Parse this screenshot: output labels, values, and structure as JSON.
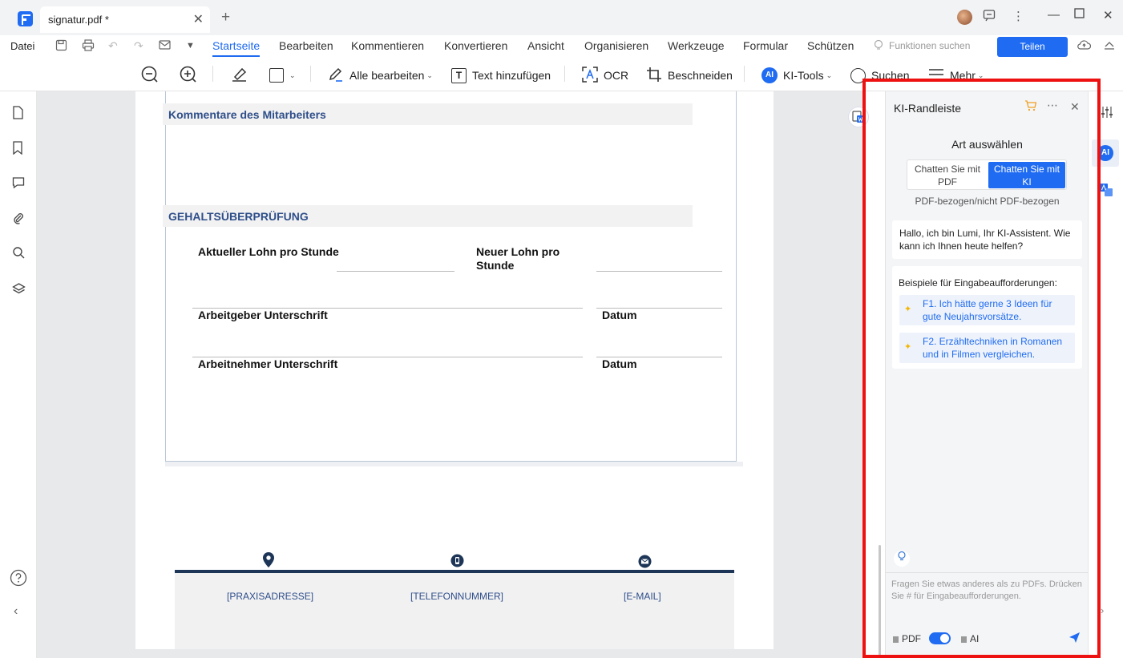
{
  "titlebar": {
    "tab_name": "signatur.pdf *",
    "close": "✕",
    "new_tab": "+"
  },
  "menubar": {
    "file": "Datei",
    "tabs": [
      "Startseite",
      "Bearbeiten",
      "Kommentieren",
      "Konvertieren",
      "Ansicht",
      "Organisieren",
      "Werkzeuge",
      "Formular",
      "Schützen"
    ],
    "feature_search": "Funktionen suchen",
    "share": "Teilen"
  },
  "toolbar": {
    "edit_all": "Alle bearbeiten",
    "add_text": "Text hinzufügen",
    "ocr": "OCR",
    "crop": "Beschneiden",
    "ai_tools": "KI-Tools",
    "search": "Suchen",
    "more": "Mehr",
    "ai_badge": "AI",
    "text_icon": "T"
  },
  "document": {
    "section_comments": "Kommentare des Mitarbeiters",
    "section_salary": "GEHALTSÜBERPRÜFUNG",
    "current_wage": "Aktueller Lohn pro Stunde",
    "new_wage_line1": "Neuer Lohn pro",
    "new_wage_line2": "Stunde",
    "employer_sign": "Arbeitgeber Unterschrift",
    "employee_sign": "Arbeitnehmer Unterschrift",
    "date1": "Datum",
    "date2": "Datum",
    "footer_address": "[PRAXISADRESSE]",
    "footer_phone": "[TELEFONNUMMER]",
    "footer_email": "[E-MAIL]"
  },
  "ai_panel": {
    "title": "KI-Randleiste",
    "mode_title": "Art auswählen",
    "mode_pdf_line1": "Chatten Sie mit",
    "mode_pdf_line2": "PDF",
    "mode_ai_line1": "Chatten Sie mit",
    "mode_ai_line2": "KI",
    "mode_sub": "PDF-bezogen/nicht PDF-bezogen",
    "greeting": "Hallo, ich bin Lumi, Ihr KI-Assistent. Wie kann ich Ihnen heute helfen?",
    "examples_title": "Beispiele für Eingabeaufforderungen:",
    "examples": [
      "F1. Ich hätte gerne 3 Ideen für gute Neujahrsvorsätze.",
      "F2. Erzähltechniken in Romanen und in Filmen vergleichen."
    ],
    "input_placeholder": "Fragen Sie etwas anderes als zu PDFs. Drücken Sie # für Eingabeaufforderungen.",
    "toggle_left": "PDF",
    "toggle_right": "AI",
    "toggle_state": "AI"
  },
  "rightrail": {
    "ai_badge": "AI"
  },
  "colors": {
    "accent": "#1f6bf2",
    "highlight": "#ee1111",
    "doc_heading": "#2f4f8a",
    "footer_bar": "#1d3557"
  }
}
